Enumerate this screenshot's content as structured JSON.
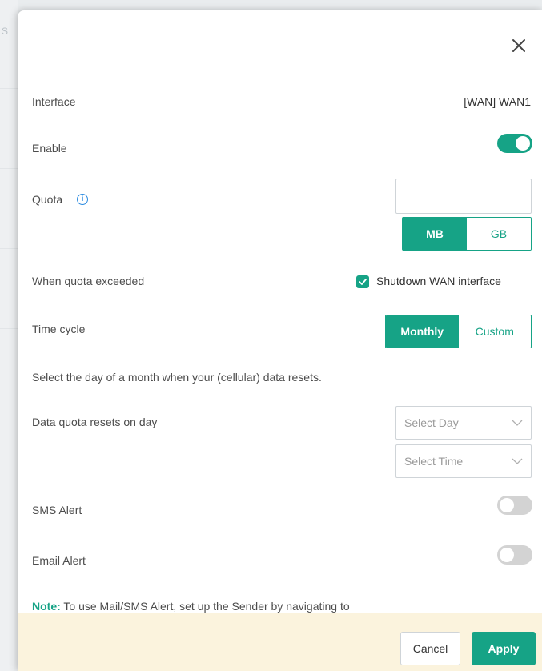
{
  "background": {
    "faint_text": "S"
  },
  "dialog": {
    "close_icon": "close-icon",
    "interface": {
      "label": "Interface",
      "value": "[WAN] WAN1"
    },
    "enable": {
      "label": "Enable",
      "state": "on"
    },
    "quota": {
      "label": "Quota",
      "info_icon": "info-icon",
      "value": "",
      "units": [
        "MB",
        "GB"
      ],
      "selected_unit": "MB"
    },
    "quota_exceeded": {
      "label": "When quota exceeded",
      "checkbox_label": "Shutdown WAN interface",
      "checked": true
    },
    "time_cycle": {
      "label": "Time cycle",
      "options": [
        "Monthly",
        "Custom"
      ],
      "selected": "Monthly"
    },
    "reset_help": "Select the day of a month when your (cellular) data resets.",
    "reset_day": {
      "label": "Data quota resets on day",
      "day_placeholder": "Select Day",
      "time_placeholder": "Select Time"
    },
    "sms_alert": {
      "label": "SMS Alert",
      "state": "off"
    },
    "email_alert": {
      "label": "Email Alert",
      "state": "off"
    },
    "note": {
      "key": "Note:",
      "text": " To use Mail/SMS Alert, set up the Sender by navigating to"
    }
  },
  "footer": {
    "cancel_label": "Cancel",
    "apply_label": "Apply"
  },
  "colors": {
    "accent": "#16a386",
    "footer_bg": "#fbf3dd",
    "toggle_off": "#d3d3d3",
    "info": "#2a8ae0"
  }
}
